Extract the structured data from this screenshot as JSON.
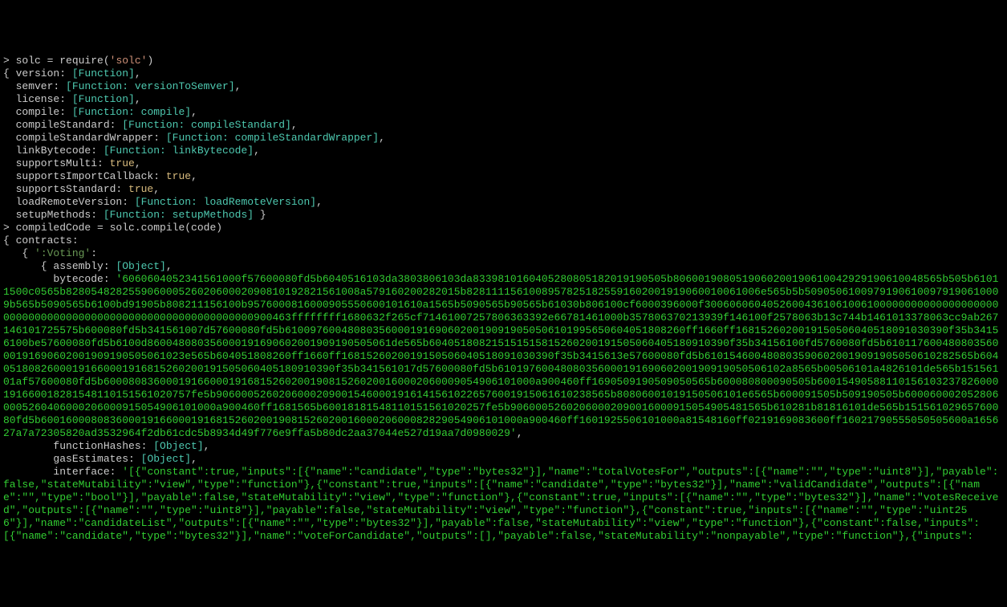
{
  "lines": {
    "l1_prompt": "> ",
    "l1_text": "solc = require(",
    "l1_str": "'solc'",
    "l1_end": ")",
    "l2": "{ version: ",
    "l2_cyan": "[Function]",
    "l2_end": ",",
    "l3": "  semver: ",
    "l3_cyan": "[Function: versionToSemver]",
    "l3_end": ",",
    "l4": "  license: ",
    "l4_cyan": "[Function]",
    "l4_end": ",",
    "l5": "  compile: ",
    "l5_cyan": "[Function: compile]",
    "l5_end": ",",
    "l6": "  compileStandard: ",
    "l6_cyan": "[Function: compileStandard]",
    "l6_end": ",",
    "l7": "  compileStandardWrapper: ",
    "l7_cyan": "[Function: compileStandardWrapper]",
    "l7_end": ",",
    "l8": "  linkBytecode: ",
    "l8_cyan": "[Function: linkBytecode]",
    "l8_end": ",",
    "l9": "  supportsMulti: ",
    "l9_yellow": "true",
    "l9_end": ",",
    "l10": "  supportsImportCallback: ",
    "l10_yellow": "true",
    "l10_end": ",",
    "l11": "  supportsStandard: ",
    "l11_yellow": "true",
    "l11_end": ",",
    "l12": "  loadRemoteVersion: ",
    "l12_cyan": "[Function: loadRemoteVersion]",
    "l12_end": ",",
    "l13": "  setupMethods: ",
    "l13_cyan": "[Function: setupMethods]",
    "l13_end": " }",
    "l14_prompt": "> ",
    "l14_text": "compiledCode = solc.compile(code)",
    "l15": "{ contracts:",
    "l16": "   { ",
    "l16_green": "':Voting'",
    "l16_end": ":",
    "l17": "      { assembly: ",
    "l17_cyan": "[Object]",
    "l17_end": ",",
    "l18": "        bytecode: ",
    "l18_bytecode": "'6060604052341561000f57600080fd5b6040516103da3803806103da8339810160405280805182019190505b8060019080519060200190610042929190610048565b505b61011500c0565b82805482825590600052602060002090810192821561008a579160200282015b82811115610089578251825591602001919060010061006e565b5b50905061009791906100979190610009b565b5090565b6100bd91905b808211156100b9576000816000905550600101610a1565b5090565b90565b61030b806100cf6000396000f300606060405260043610610061000000000000000000000000000000000000000000000000000000000000900463ffffffff1680632f265cf71461007257806363392e66781461000b357806370213939f146100f2578063b13c744b1461013378063cc9ab267146101725575b600080fd5b341561007d57600080fd5b6100976004808035600019169060200190919050506101995650604051808260ff1660ff1681526020019150506040518091030390f35b34156100be57600080fd5b6100d860048080356000191690602001909190505061de565b604051808215151515815260200191505060405180910390f35b34156100fd5760080fd5b61011760048080356000191690602001909190505061023e565b604051808260ff1660ff1681526020019150506040518091030390f35b3415613e57600080fd5b6101546004808035906020019091905050610282565b60405180826000191660001916815260200191505060405180910390f35b341561017d57600080fd5b6101976004808035600019169060200190919050506102a8565b00506101a4826101de565b15156101af57600080fd5b600080836000191660001916815260200190815260200160002060009054906101000a900460ff1690509190509050565b600080800090505b60015490588110156103237826000191660018281548110151561020757fe5b906000526020600020900154600019161415610226576001915061610238565b80806001019150506101e6565b600091505b509190505b6000600020528060005260406000206000915054906101000a900460ff1681565b60018181548110151561020257fe5b90600052602060002090016000915054905481565b610281b81816101de565b15156102965760080fd5b60016000808360001916600019168152602001908152602001600020600082829054906101000a900460ff1601925506101000a81548160ff0219169083600ff16021790555050505600a165627a7a72305820ad3532964f2db61cdc5b8934d49f776e9ffa5b80dc2aa37044e527d19aa7d0980029'",
    "l18_end": ",",
    "l19": "        functionHashes: ",
    "l19_cyan": "[Object]",
    "l19_end": ",",
    "l20": "        gasEstimates: ",
    "l20_cyan": "[Object]",
    "l20_end": ",",
    "l21": "        interface: ",
    "l21_interface": "'[{\"constant\":true,\"inputs\":[{\"name\":\"candidate\",\"type\":\"bytes32\"}],\"name\":\"totalVotesFor\",\"outputs\":[{\"name\":\"\",\"type\":\"uint8\"}],\"payable\":false,\"stateMutability\":\"view\",\"type\":\"function\"},{\"constant\":true,\"inputs\":[{\"name\":\"candidate\",\"type\":\"bytes32\"}],\"name\":\"validCandidate\",\"outputs\":[{\"name\":\"\",\"type\":\"bool\"}],\"payable\":false,\"stateMutability\":\"view\",\"type\":\"function\"},{\"constant\":true,\"inputs\":[{\"name\":\"\",\"type\":\"bytes32\"}],\"name\":\"votesReceived\",\"outputs\":[{\"name\":\"\",\"type\":\"uint8\"}],\"payable\":false,\"stateMutability\":\"view\",\"type\":\"function\"},{\"constant\":true,\"inputs\":[{\"name\":\"\",\"type\":\"uint256\"}],\"name\":\"candidateList\",\"outputs\":[{\"name\":\"\",\"type\":\"bytes32\"}],\"payable\":false,\"stateMutability\":\"view\",\"type\":\"function\"},{\"constant\":false,\"inputs\":[{\"name\":\"candidate\",\"type\":\"bytes32\"}],\"name\":\"voteForCandidate\",\"outputs\":[],\"payable\":false,\"stateMutability\":\"nonpayable\",\"type\":\"function\"},{\"inputs\":"
  }
}
